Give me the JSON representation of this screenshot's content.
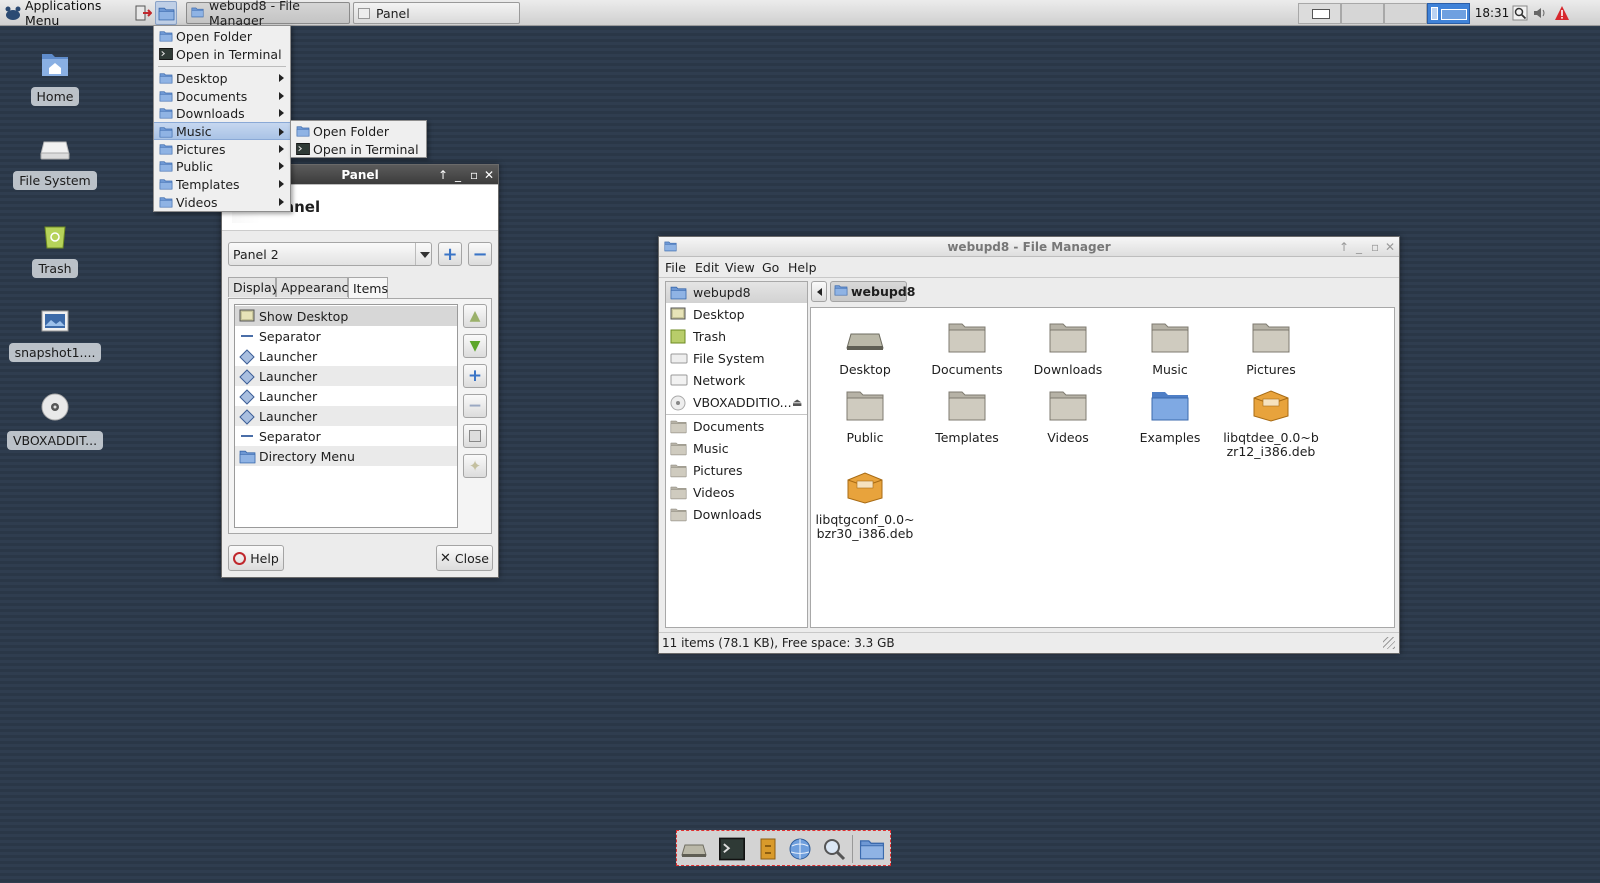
{
  "top_panel": {
    "apps_menu_label": "Applications Menu",
    "tasks": [
      {
        "label": "webupd8 - File Manager",
        "active": true
      },
      {
        "label": "Panel",
        "active": false
      }
    ],
    "clock": "18:31"
  },
  "desktop_icons": [
    {
      "label": "Home",
      "icon": "home-folder-icon"
    },
    {
      "label": "File System",
      "icon": "drive-icon"
    },
    {
      "label": "Trash",
      "icon": "trash-icon"
    },
    {
      "label": "snapshot1....",
      "icon": "image-file-icon"
    },
    {
      "label": "VBOXADDIT...",
      "icon": "cdrom-icon"
    }
  ],
  "directory_menu": {
    "items": [
      {
        "label": "Open Folder",
        "icon": "folder-icon"
      },
      {
        "label": "Open in Terminal",
        "icon": "terminal-icon"
      },
      {
        "label": "Desktop",
        "icon": "folder-icon",
        "submenu": true
      },
      {
        "label": "Documents",
        "icon": "folder-icon",
        "submenu": true
      },
      {
        "label": "Downloads",
        "icon": "folder-icon",
        "submenu": true
      },
      {
        "label": "Music",
        "icon": "folder-icon",
        "submenu": true,
        "highlighted": true
      },
      {
        "label": "Pictures",
        "icon": "folder-icon",
        "submenu": true
      },
      {
        "label": "Public",
        "icon": "folder-icon",
        "submenu": true
      },
      {
        "label": "Templates",
        "icon": "folder-icon",
        "submenu": true
      },
      {
        "label": "Videos",
        "icon": "folder-icon",
        "submenu": true
      }
    ],
    "submenu": [
      {
        "label": "Open Folder",
        "icon": "folder-icon"
      },
      {
        "label": "Open in Terminal",
        "icon": "terminal-icon"
      }
    ]
  },
  "panel_window": {
    "title": "Panel",
    "heading": "anel",
    "panel_select": "Panel 2",
    "tabs": [
      {
        "label": "Display",
        "active": false
      },
      {
        "label": "Appearance",
        "active": false
      },
      {
        "label": "Items",
        "active": true
      }
    ],
    "items": [
      {
        "label": "Show Desktop",
        "icon": "show-desktop-icon"
      },
      {
        "label": "Separator",
        "icon": "separator-icon"
      },
      {
        "label": "Launcher",
        "icon": "launcher-icon"
      },
      {
        "label": "Launcher",
        "icon": "launcher-icon"
      },
      {
        "label": "Launcher",
        "icon": "launcher-icon"
      },
      {
        "label": "Launcher",
        "icon": "launcher-icon"
      },
      {
        "label": "Separator",
        "icon": "separator-icon"
      },
      {
        "label": "Directory Menu",
        "icon": "folder-icon"
      }
    ],
    "help_label": "Help",
    "close_label": "Close"
  },
  "file_manager": {
    "title": "webupd8 - File Manager",
    "menubar": [
      "File",
      "Edit",
      "View",
      "Go",
      "Help"
    ],
    "path_button": "webupd8",
    "sidebar_devices": [
      {
        "label": "webupd8",
        "icon": "home-folder-icon"
      },
      {
        "label": "Desktop",
        "icon": "desktop-icon"
      },
      {
        "label": "Trash",
        "icon": "trash-icon"
      },
      {
        "label": "File System",
        "icon": "drive-icon"
      },
      {
        "label": "Network",
        "icon": "network-icon"
      },
      {
        "label": "VBOXADDITIO...",
        "icon": "cdrom-icon"
      }
    ],
    "sidebar_places": [
      {
        "label": "Documents",
        "icon": "folder-icon"
      },
      {
        "label": "Music",
        "icon": "folder-icon"
      },
      {
        "label": "Pictures",
        "icon": "folder-icon"
      },
      {
        "label": "Videos",
        "icon": "folder-icon"
      },
      {
        "label": "Downloads",
        "icon": "folder-icon"
      }
    ],
    "files": [
      {
        "label": "Desktop",
        "icon": "desktop-icon"
      },
      {
        "label": "Documents",
        "icon": "documents-folder-icon"
      },
      {
        "label": "Downloads",
        "icon": "downloads-folder-icon"
      },
      {
        "label": "Music",
        "icon": "music-folder-icon"
      },
      {
        "label": "Pictures",
        "icon": "pictures-folder-icon"
      },
      {
        "label": "Public",
        "icon": "public-folder-icon"
      },
      {
        "label": "Templates",
        "icon": "templates-folder-icon"
      },
      {
        "label": "Videos",
        "icon": "videos-folder-icon"
      },
      {
        "label": "Examples",
        "icon": "blue-folder-icon"
      },
      {
        "label": "libqtdee_0.0~bzr12_i386.deb",
        "icon": "package-icon"
      },
      {
        "label": "libqtgconf_0.0~bzr30_i386.deb",
        "icon": "package-icon"
      }
    ],
    "status": "11 items (78.1 KB), Free space: 3.3 GB"
  },
  "colors": {
    "desktop_bg": "#2f3d4f",
    "highlight": "#a9c3e6",
    "workspace_active": "#3f82d8",
    "folder_fill": "#c9c5b8",
    "package_orange": "#e8a33c"
  }
}
